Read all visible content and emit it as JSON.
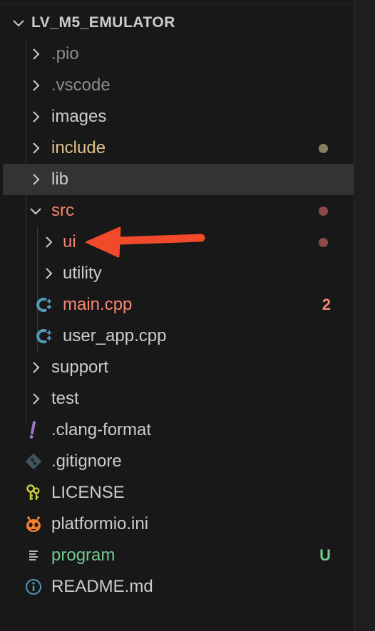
{
  "explorer": {
    "section_title": "LV_M5_EMULATOR",
    "tree": {
      "pio": ".pio",
      "vscode": ".vscode",
      "images": "images",
      "include": "include",
      "lib": "lib",
      "src": "src",
      "ui": "ui",
      "utility": "utility",
      "main_cpp": "main.cpp",
      "main_cpp_problems": "2",
      "user_app_cpp": "user_app.cpp",
      "support": "support",
      "test": "test",
      "clang_format": ".clang-format",
      "gitignore": ".gitignore",
      "license": "LICENSE",
      "platformio_ini": "platformio.ini",
      "program": "program",
      "program_status": "U",
      "readme": "README.md"
    }
  },
  "colors": {
    "modified_dot": "#8a7f62",
    "error_dot": "#8a4a48",
    "error_text": "#f48771",
    "untracked_text": "#73c991",
    "annotation_arrow": "#f04a2a",
    "cpp_icon": "#519aba",
    "info_icon": "#519aba",
    "license_icon": "#cbcb41",
    "clang_icon": "#a074c4",
    "git_icon": "#41535b"
  },
  "icons": {
    "chevron_right": "chevron-right-icon",
    "chevron_down": "chevron-down-icon",
    "cpp": "cpp-file-icon",
    "exclamation": "exclamation-icon",
    "git": "git-diamond-icon",
    "key": "key-icon",
    "platformio": "platformio-alien-icon",
    "lines": "text-lines-icon",
    "info": "info-circle-icon",
    "arrow": "annotation-arrow-icon"
  }
}
